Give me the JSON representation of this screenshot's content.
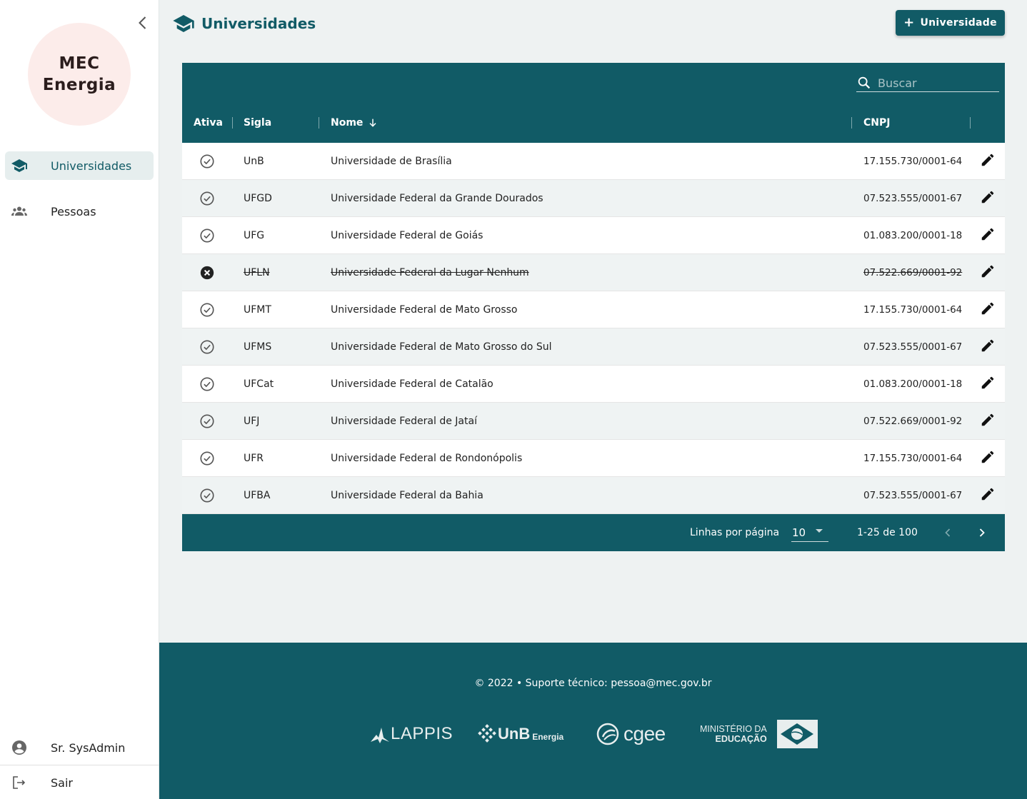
{
  "app": {
    "logo_line1": "MEC",
    "logo_line2": "Energia"
  },
  "sidebar": {
    "items": [
      {
        "label": "Universidades",
        "icon": "school-icon",
        "active": true
      },
      {
        "label": "Pessoas",
        "icon": "people-icon",
        "active": false
      }
    ],
    "user": {
      "label": "Sr. SysAdmin",
      "icon": "account-circle-icon"
    },
    "logout": {
      "label": "Sair",
      "icon": "logout-icon"
    }
  },
  "header": {
    "title": "Universidades",
    "add_button_label": "Universidade"
  },
  "search": {
    "placeholder": "Buscar",
    "value": ""
  },
  "table": {
    "columns": {
      "ativa": "Ativa",
      "sigla": "Sigla",
      "nome": "Nome",
      "cnpj": "CNPJ"
    },
    "sort": {
      "column": "nome",
      "direction": "desc"
    },
    "rows": [
      {
        "active": true,
        "sigla": "UnB",
        "nome": "Universidade de Brasília",
        "cnpj": "17.155.730/0001-64"
      },
      {
        "active": true,
        "sigla": "UFGD",
        "nome": "Universidade Federal da Grande Dourados",
        "cnpj": "07.523.555/0001-67"
      },
      {
        "active": true,
        "sigla": "UFG",
        "nome": "Universidade Federal de Goiás",
        "cnpj": "01.083.200/0001-18"
      },
      {
        "active": false,
        "sigla": "UFLN",
        "nome": "Universidade Federal da Lugar Nenhum",
        "cnpj": "07.522.669/0001-92"
      },
      {
        "active": true,
        "sigla": "UFMT",
        "nome": "Universidade Federal de Mato Grosso",
        "cnpj": "17.155.730/0001-64"
      },
      {
        "active": true,
        "sigla": "UFMS",
        "nome": "Universidade Federal de Mato Grosso do Sul",
        "cnpj": "07.523.555/0001-67"
      },
      {
        "active": true,
        "sigla": "UFCat",
        "nome": "Universidade Federal de Catalão",
        "cnpj": "01.083.200/0001-18"
      },
      {
        "active": true,
        "sigla": "UFJ",
        "nome": "Universidade Federal de Jataí",
        "cnpj": "07.522.669/0001-92"
      },
      {
        "active": true,
        "sigla": "UFR",
        "nome": "Universidade Federal de Rondonópolis",
        "cnpj": "17.155.730/0001-64"
      },
      {
        "active": true,
        "sigla": "UFBA",
        "nome": "Universidade Federal da Bahia",
        "cnpj": "07.523.555/0001-67"
      }
    ]
  },
  "pagination": {
    "rows_per_page_label": "Linhas por página",
    "rows_per_page": "10",
    "range": "1-25 de 100"
  },
  "footer": {
    "copyright": "© 2022  •  Suporte técnico: pessoa@mec.gov.br",
    "partners": {
      "lappis": "LAPPIS",
      "unb": "UnB",
      "unb_sub": "Energia",
      "cgee": "cgee",
      "mec_line1": "MINISTÉRIO DA",
      "mec_line2": "EDUCAÇÃO"
    }
  },
  "colors": {
    "primary": "#115b66",
    "background": "#eef2f2",
    "logo_bg": "#fcecea",
    "active_nav_bg": "#e6eeee"
  }
}
